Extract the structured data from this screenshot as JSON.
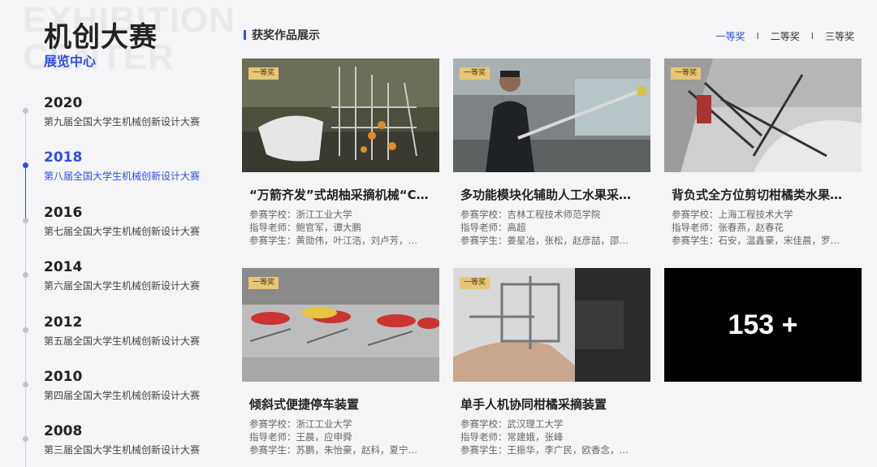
{
  "brand": {
    "watermark": "EXHIBITION\nCENTER",
    "title": "机创大赛",
    "subtitle": "展览中心"
  },
  "timeline": [
    {
      "year": "2020",
      "desc": "第九届全国大学生机械创新设计大赛",
      "active": false
    },
    {
      "year": "2018",
      "desc": "第八届全国大学生机械创新设计大赛",
      "active": true
    },
    {
      "year": "2016",
      "desc": "第七届全国大学生机械创新设计大赛",
      "active": false
    },
    {
      "year": "2014",
      "desc": "第六届全国大学生机械创新设计大赛",
      "active": false
    },
    {
      "year": "2012",
      "desc": "第五届全国大学生机械创新设计大赛",
      "active": false
    },
    {
      "year": "2010",
      "desc": "第四届全国大学生机械创新设计大赛",
      "active": false
    },
    {
      "year": "2008",
      "desc": "第三届全国大学生机械创新设计大赛",
      "active": false
    }
  ],
  "header": {
    "title": "获奖作品展示",
    "tabs": [
      {
        "label": "一等奖",
        "active": true
      },
      {
        "label": "二等奖",
        "active": false
      },
      {
        "label": "三等奖",
        "active": false
      }
    ],
    "separator": "I"
  },
  "cards": [
    {
      "badge": "一等奖",
      "title": "“万箭齐发”式胡柚采摘机械“C…",
      "school": "参赛学校：浙江工业大学",
      "teacher": "指导老师：鲍官军，谭大鹏",
      "students": "参赛学生：黄勋伟，叶江浩，刘卢芳，…"
    },
    {
      "badge": "一等奖",
      "title": "多功能模块化辅助人工水果采…",
      "school": "参赛学校：吉林工程技术师范学院",
      "teacher": "指导老师：高超",
      "students": "参赛学生：姜星冶，张松，赵彦喆，邵…"
    },
    {
      "badge": "一等奖",
      "title": "背负式全方位剪切柑橘类水果…",
      "school": "参赛学校：上海工程技术大学",
      "teacher": "指导老师：张春燕，赵春花",
      "students": "参赛学生：石安，温鑫豪，宋佳晨，罗…"
    },
    {
      "badge": "一等奖",
      "title": "倾斜式便捷停车装置",
      "school": "参赛学校：浙江工业大学",
      "teacher": "指导老师：王晨，应申舜",
      "students": "参赛学生：苏鹏，朱怡豪，赵科，夏宁…"
    },
    {
      "badge": "一等奖",
      "title": "单手人机协同柑橘采摘装置",
      "school": "参赛学校：武汉理工大学",
      "teacher": "指导老师：常建娥，张峰",
      "students": "参赛学生：王振华，李广民，欧香念，…"
    }
  ],
  "more": {
    "label": "153 +"
  },
  "colors": {
    "accent": "#2f4fe0",
    "badge": "#e8c774"
  }
}
